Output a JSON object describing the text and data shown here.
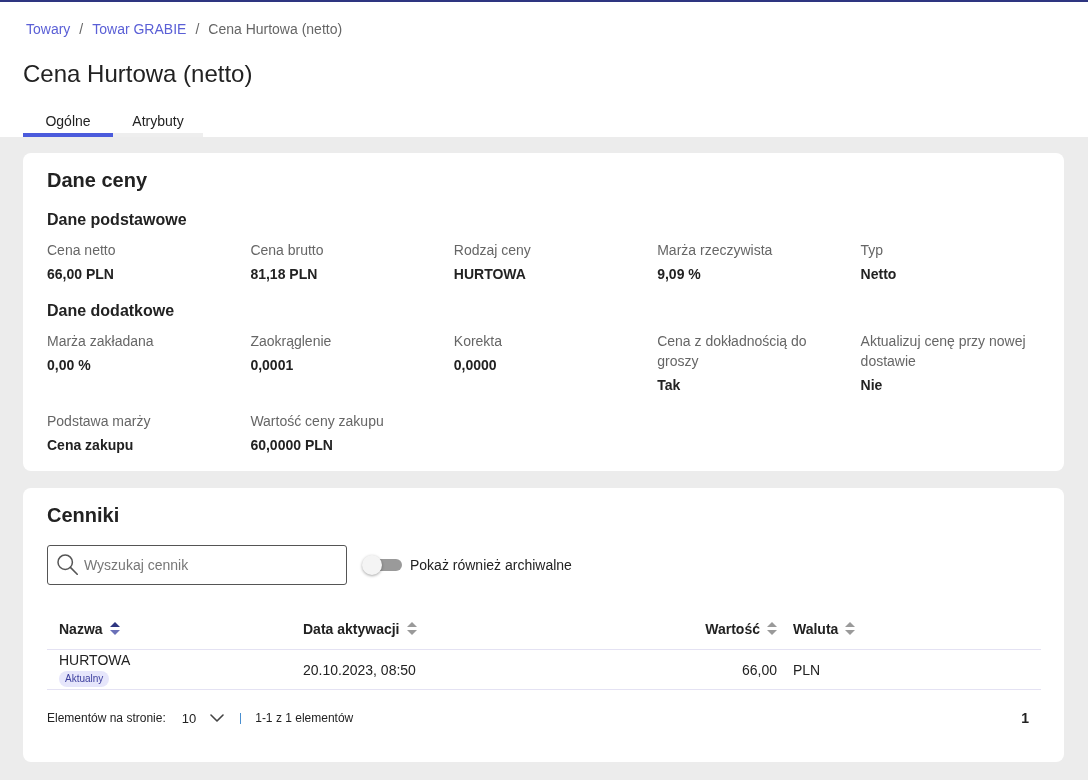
{
  "breadcrumbs": [
    {
      "kind": "link",
      "text": "Towary"
    },
    {
      "kind": "separator",
      "text": "/"
    },
    {
      "kind": "link",
      "text": "Towar GRABIE"
    },
    {
      "kind": "separator",
      "text": "/"
    },
    {
      "kind": "current",
      "text": "Cena Hurtowa (netto)"
    }
  ],
  "page_title": "Cena Hurtowa (netto)",
  "tabs": [
    {
      "label": "Ogólne",
      "selected": true
    },
    {
      "label": "Atrybuty",
      "selected": false
    }
  ],
  "price_details": {
    "title": "Dane ceny",
    "sections": [
      {
        "title": "Dane podstawowe",
        "fields": [
          {
            "label": "Cena netto",
            "value": "66,00 PLN"
          },
          {
            "label": "Cena brutto",
            "value": "81,18 PLN"
          },
          {
            "label": "Rodzaj ceny",
            "value": "HURTOWA"
          },
          {
            "label": "Marża rzeczywista",
            "value": "9,09 %"
          },
          {
            "label": "Typ",
            "value": "Netto"
          }
        ]
      },
      {
        "title": "Dane dodatkowe",
        "fields": [
          {
            "label": "Marża zakładana",
            "value": "0,00 %"
          },
          {
            "label": "Zaokrąglenie",
            "value": "0,0001"
          },
          {
            "label": "Korekta",
            "value": "0,0000"
          },
          {
            "label": "Cena z dokładnością do groszy",
            "value": "Tak"
          },
          {
            "label": "Aktualizuj cenę przy nowej dostawie",
            "value": "Nie"
          },
          {
            "label": "Podstawa marży",
            "value": "Cena zakupu"
          },
          {
            "label": "Wartość ceny zakupu",
            "value": "60,0000 PLN"
          }
        ]
      }
    ]
  },
  "price_lists": {
    "title": "Cenniki",
    "search": {
      "placeholder": "Wyszukaj cennik"
    },
    "archive_toggle": {
      "label": "Pokaż również archiwalne",
      "on": false
    },
    "table": {
      "columns": [
        {
          "label": "Nazwa",
          "kind": "text",
          "sorted": true
        },
        {
          "label": "Data aktywacji",
          "kind": "text",
          "sorted": false
        },
        {
          "label": "Wartość",
          "kind": "number",
          "sorted": false
        },
        {
          "label": "Waluta",
          "kind": "text",
          "sorted": false
        }
      ],
      "rows": [
        {
          "cells": [
            {
              "text": "HURTOWA",
              "tag": "Aktualny"
            },
            {
              "text": "20.10.2023, 08:50"
            },
            {
              "text": "66,00"
            },
            {
              "text": "PLN"
            }
          ]
        }
      ]
    },
    "pagination": {
      "page_size_label": "Elementów na stronie:",
      "page_size": "10",
      "range": "1-1 z 1 elementów",
      "pages": [
        {
          "label": "1",
          "selected": true
        }
      ]
    }
  }
}
